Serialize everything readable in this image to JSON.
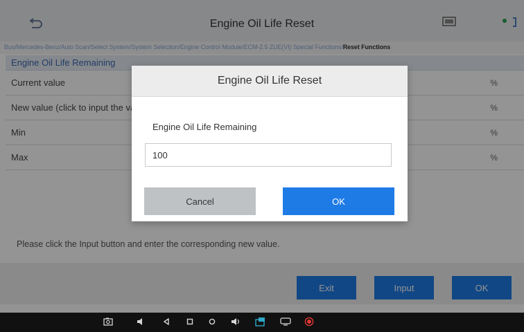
{
  "header": {
    "title": "Engine Oil Life Reset",
    "breadcrumb_path": "Bus/Mercedes-Benz/Auto Scan/Select System/System Selection/Engine Control Module/ECM-2.5 ZUE(VI) Special Functions/",
    "breadcrumb_current": "Reset Functions"
  },
  "table": {
    "header": "Engine Oil Life Remaining",
    "rows": [
      {
        "label": "Current value",
        "unit": "%"
      },
      {
        "label": "New value (click to input the value)",
        "unit": "%"
      },
      {
        "label": "Min",
        "unit": "%"
      },
      {
        "label": "Max",
        "unit": "%"
      }
    ]
  },
  "hint": "Please click the Input button and enter the corresponding new value.",
  "footer": {
    "exit_label": "Exit",
    "input_label": "Input",
    "ok_label": "OK"
  },
  "dialog": {
    "title": "Engine Oil Life Reset",
    "field_label": "Engine Oil Life Remaining",
    "value": "100",
    "cancel_label": "Cancel",
    "ok_label": "OK"
  },
  "icons": [
    "back-icon",
    "vci-icon",
    "connection-icon",
    "screenshot-icon",
    "volume-down-icon",
    "nav-back-icon",
    "nav-home-icon",
    "nav-recent-icon",
    "volume-up-icon",
    "vehicle-icon",
    "display-icon",
    "record-icon"
  ],
  "colors": {
    "accent": "#1e7be6",
    "link": "#8aa5cf",
    "record": "#e53935",
    "connection": "#2e9d4f"
  }
}
